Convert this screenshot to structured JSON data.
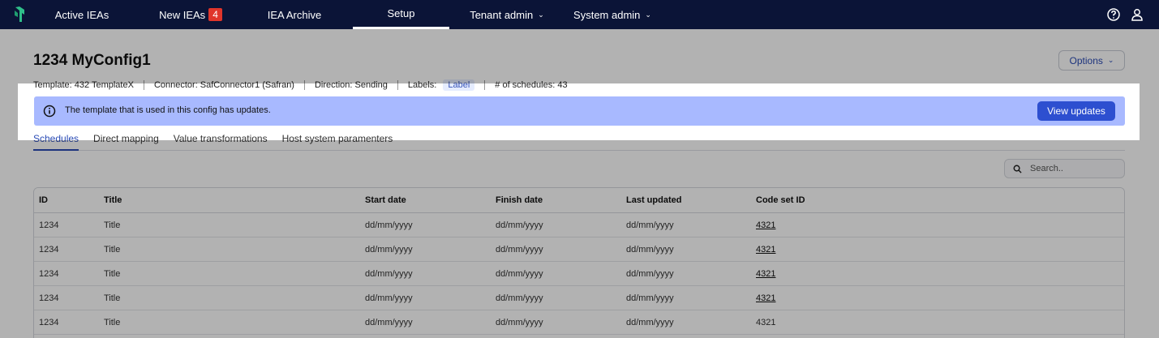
{
  "nav": {
    "items": [
      {
        "label": "Active IEAs"
      },
      {
        "label": "New IEAs",
        "badge": "4"
      },
      {
        "label": "IEA Archive"
      },
      {
        "label": "Setup"
      },
      {
        "label": "Tenant admin"
      },
      {
        "label": "System admin"
      }
    ]
  },
  "header": {
    "title": "1234 MyConfig1",
    "options_label": "Options"
  },
  "meta": {
    "template": "Template: 432 TemplateX",
    "connector": "Connector: SafConnector1  (Safran)",
    "direction": "Direction: Sending",
    "labels_prefix": "Labels:",
    "label_chip": "Label",
    "schedules": "# of schedules: 43"
  },
  "banner": {
    "text": "The template that is used in this config has updates.",
    "button": "View updates"
  },
  "tabs": [
    "Schedules",
    "Direct mapping",
    "Value transformations",
    "Host system paramenters"
  ],
  "search": {
    "placeholder": "Search.."
  },
  "table": {
    "headers": [
      "ID",
      "Title",
      "Start date",
      "Finish date",
      "Last updated",
      "Code set ID"
    ],
    "rows": [
      [
        "1234",
        "Title",
        "dd/mm/yyyy",
        "dd/mm/yyyy",
        "dd/mm/yyyy",
        "4321"
      ],
      [
        "1234",
        "Title",
        "dd/mm/yyyy",
        "dd/mm/yyyy",
        "dd/mm/yyyy",
        "4321"
      ],
      [
        "1234",
        "Title",
        "dd/mm/yyyy",
        "dd/mm/yyyy",
        "dd/mm/yyyy",
        "4321"
      ],
      [
        "1234",
        "Title",
        "dd/mm/yyyy",
        "dd/mm/yyyy",
        "dd/mm/yyyy",
        "4321"
      ],
      [
        "1234",
        "Title",
        "dd/mm/yyyy",
        "dd/mm/yyyy",
        "dd/mm/yyyy",
        "4321"
      ]
    ]
  },
  "colors": {
    "nav_bg": "#0b1437",
    "accent": "#2d4fd0",
    "banner_bg": "#a8b9ff",
    "badge": "#e0352b"
  }
}
